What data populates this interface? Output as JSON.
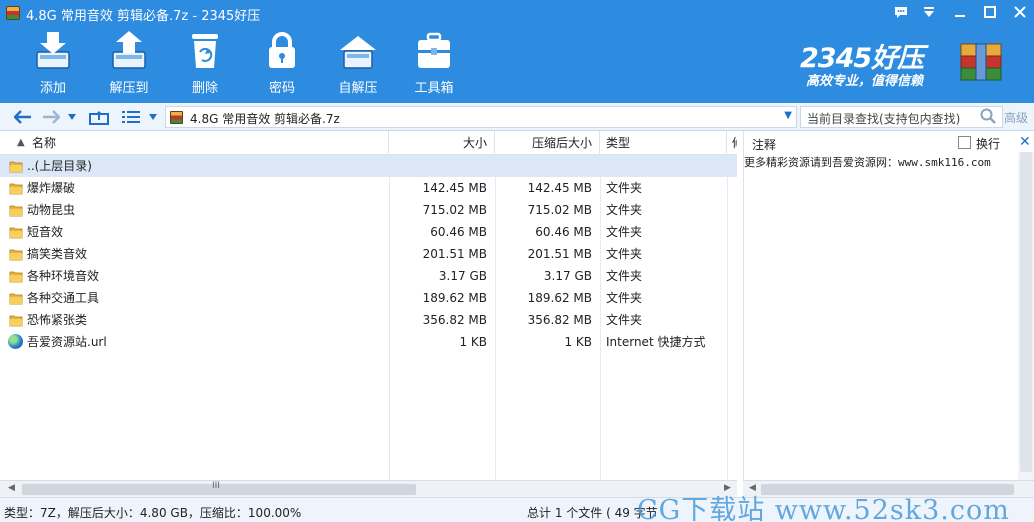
{
  "window": {
    "title": "4.8G 常用音效 剪辑必备.7z - 2345好压",
    "controls": [
      "feedback-icon",
      "menu-down-icon",
      "minimize-icon",
      "maximize-icon",
      "close-icon"
    ]
  },
  "toolbar": {
    "items": [
      {
        "label": "添加",
        "icon": "add-archive-icon"
      },
      {
        "label": "解压到",
        "icon": "extract-to-icon"
      },
      {
        "label": "删除",
        "icon": "delete-bin-icon"
      },
      {
        "label": "密码",
        "icon": "lock-icon"
      },
      {
        "label": "自解压",
        "icon": "self-extract-icon"
      },
      {
        "label": "工具箱",
        "icon": "toolbox-icon"
      }
    ]
  },
  "brand": {
    "logo": "2345好压",
    "slogan": "高效专业，值得信赖"
  },
  "nav": {
    "address": "4.8G 常用音效 剪辑必备.7z",
    "search_placeholder": "当前目录查找(支持包内查找)",
    "advanced": "高级"
  },
  "list": {
    "columns": {
      "name": "名称",
      "size": "大小",
      "packed": "压缩后大小",
      "type": "类型",
      "extra": "修"
    },
    "rows": [
      {
        "name": "..(上层目录)",
        "size": "",
        "packed": "",
        "type": "",
        "icon": "folder-icon"
      },
      {
        "name": "爆炸爆破",
        "size": "142.45 MB",
        "packed": "142.45 MB",
        "type": "文件夹",
        "icon": "folder-icon"
      },
      {
        "name": "动物昆虫",
        "size": "715.02 MB",
        "packed": "715.02 MB",
        "type": "文件夹",
        "icon": "folder-icon"
      },
      {
        "name": "短音效",
        "size": "60.46 MB",
        "packed": "60.46 MB",
        "type": "文件夹",
        "icon": "folder-icon"
      },
      {
        "name": "搞笑类音效",
        "size": "201.51 MB",
        "packed": "201.51 MB",
        "type": "文件夹",
        "icon": "folder-icon"
      },
      {
        "name": "各种环境音效",
        "size": "3.17 GB",
        "packed": "3.17 GB",
        "type": "文件夹",
        "icon": "folder-icon"
      },
      {
        "name": "各种交通工具",
        "size": "189.62 MB",
        "packed": "189.62 MB",
        "type": "文件夹",
        "icon": "folder-icon"
      },
      {
        "name": "恐怖紧张类",
        "size": "356.82 MB",
        "packed": "356.82 MB",
        "type": "文件夹",
        "icon": "folder-icon"
      },
      {
        "name": "吾爱资源站.url",
        "size": "1 KB",
        "packed": "1 KB",
        "type": "Internet 快捷方式",
        "icon": "globe-icon"
      }
    ]
  },
  "comment": {
    "title": "注释",
    "wrap_label": "换行",
    "text": "更多精彩资源请到吾爱资源网：www.smk116.com"
  },
  "scrollbar": {
    "grip": "III"
  },
  "status": {
    "left": "类型：7Z，解压后大小：4.80 GB，压缩比：100.00%",
    "middle": "总计 1 个文件 ( 49 字节"
  },
  "watermark": "CG下载站 www.52sk3.com",
  "colors": {
    "toolbar_bg": "#2d8be0",
    "nav_bg": "#eef4fb",
    "selection": "#dce8f7",
    "accent": "#1f6fc9"
  }
}
